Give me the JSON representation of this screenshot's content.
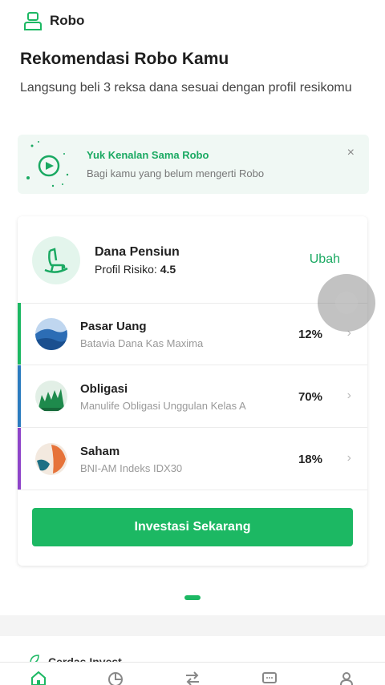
{
  "app": {
    "title": "Robo"
  },
  "page": {
    "heading": "Rekomendasi Robo Kamu",
    "subtext": "Langsung beli 3 reksa dana sesuai dengan profil resikomu"
  },
  "banner": {
    "title": "Yuk Kenalan Sama Robo",
    "subtitle": "Bagi kamu yang belum mengerti Robo",
    "close": "×"
  },
  "profile": {
    "name": "Dana Pensiun",
    "risk_label": "Profil Risiko:",
    "risk_value": "4.5",
    "edit_label": "Ubah"
  },
  "funds": [
    {
      "category": "Pasar Uang",
      "product": "Batavia Dana Kas Maxima",
      "percent": "12%",
      "color": "#1cb863"
    },
    {
      "category": "Obligasi",
      "product": "Manulife Obligasi Unggulan Kelas A",
      "percent": "70%",
      "color": "#2b7bbf"
    },
    {
      "category": "Saham",
      "product": "BNI-AM Indeks IDX30",
      "percent": "18%",
      "color": "#8e44c9"
    }
  ],
  "cta": {
    "label": "Investasi Sekarang"
  },
  "chevron": "›",
  "peek": {
    "label": "Cerdas Invest"
  },
  "nav": {
    "icons": [
      "home-icon",
      "portfolio-icon",
      "transaction-icon",
      "chat-icon",
      "account-icon"
    ]
  },
  "colors": {
    "accent": "#1cb863",
    "banner_bg": "#f0f8f4"
  }
}
